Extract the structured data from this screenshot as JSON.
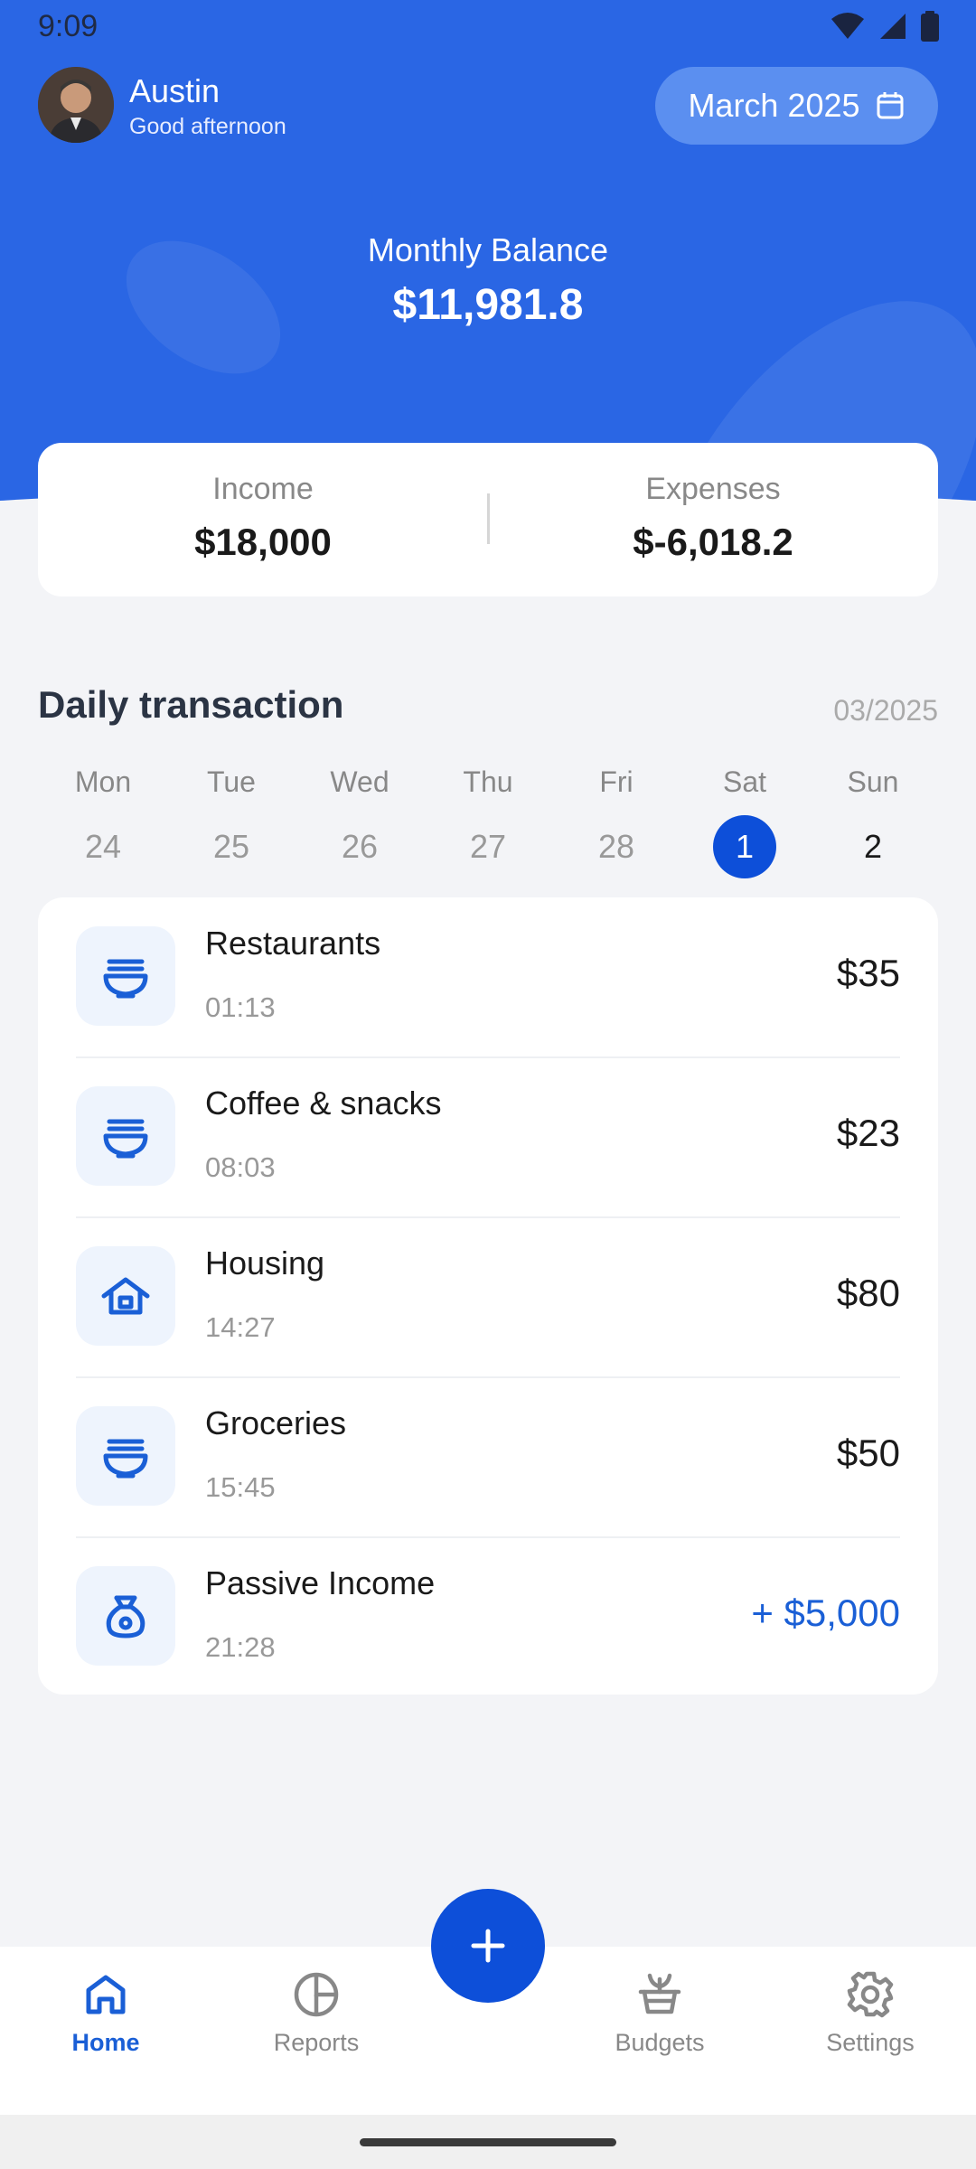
{
  "status_bar": {
    "time": "9:09"
  },
  "header": {
    "user_name": "Austin",
    "greeting": "Good afternoon",
    "month_label": "March 2025",
    "balance_label": "Monthly Balance",
    "balance_value": "$11,981.8"
  },
  "summary": {
    "income_label": "Income",
    "income_value": "$18,000",
    "expenses_label": "Expenses",
    "expenses_value": "$-6,018.2"
  },
  "daily": {
    "title": "Daily transaction",
    "period": "03/2025",
    "days": [
      {
        "name": "Mon",
        "date": "24"
      },
      {
        "name": "Tue",
        "date": "25"
      },
      {
        "name": "Wed",
        "date": "26"
      },
      {
        "name": "Thu",
        "date": "27"
      },
      {
        "name": "Fri",
        "date": "28"
      },
      {
        "name": "Sat",
        "date": "1"
      },
      {
        "name": "Sun",
        "date": "2"
      }
    ],
    "selected_day": "1"
  },
  "transactions": [
    {
      "name": "Restaurants",
      "time": "01:13",
      "amount": "$35",
      "icon": "bowl-icon"
    },
    {
      "name": "Coffee & snacks",
      "time": "08:03",
      "amount": "$23",
      "icon": "bowl-icon"
    },
    {
      "name": "Housing",
      "time": "14:27",
      "amount": "$80",
      "icon": "house-icon"
    },
    {
      "name": "Groceries",
      "time": "15:45",
      "amount": "$50",
      "icon": "bowl-icon"
    },
    {
      "name": "Passive Income",
      "time": "21:28",
      "amount": "+ $5,000",
      "icon": "money-bag-icon"
    }
  ],
  "nav": {
    "home": "Home",
    "reports": "Reports",
    "budgets": "Budgets",
    "settings": "Settings"
  },
  "colors": {
    "primary": "#2a66e4",
    "accent": "#0d4fd9",
    "income": "#1a5fd6"
  }
}
